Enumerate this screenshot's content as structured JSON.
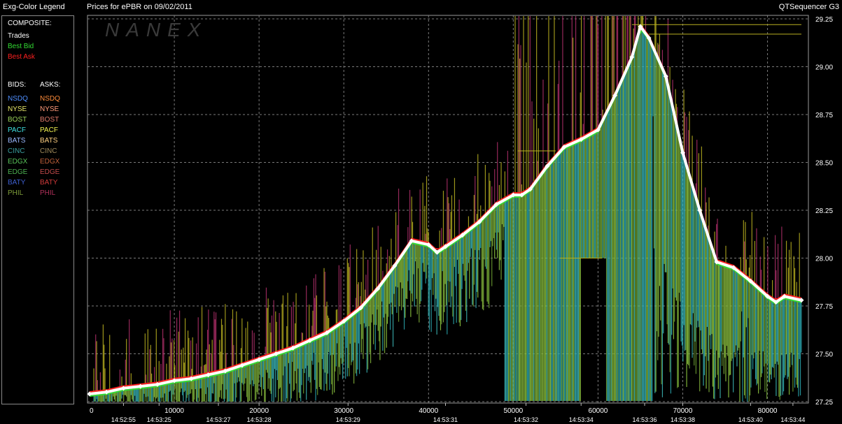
{
  "header": {
    "legend_title": "Exg-Color Legend",
    "chart_title": "Prices for  ePBR  on  09/02/2011",
    "app_name": "QTSequencer G3"
  },
  "legend": {
    "composite_label": "COMPOSITE:",
    "composite_items": [
      {
        "label": "Trades",
        "color": "#ffffff"
      },
      {
        "label": "Best Bid",
        "color": "#33dd33"
      },
      {
        "label": "Best Ask",
        "color": "#ff2020"
      }
    ],
    "bids_label": "BIDS:",
    "asks_label": "ASKS:",
    "bids": [
      {
        "label": "NSDQ",
        "color": "#4f8fff"
      },
      {
        "label": "NYSE",
        "color": "#e8e86a"
      },
      {
        "label": "BOST",
        "color": "#9ad25a"
      },
      {
        "label": "PACF",
        "color": "#40e0e0"
      },
      {
        "label": "BATS",
        "color": "#9ab8ff"
      },
      {
        "label": "CINC",
        "color": "#3aa0a0"
      },
      {
        "label": "EDGX",
        "color": "#59c45a"
      },
      {
        "label": "EDGE",
        "color": "#4caf50"
      },
      {
        "label": "BATY",
        "color": "#3e5fd0"
      },
      {
        "label": "PHIL",
        "color": "#7f9e3a"
      }
    ],
    "asks": [
      {
        "label": "NSDQ",
        "color": "#ff8c3a"
      },
      {
        "label": "NYSE",
        "color": "#ff9a7a"
      },
      {
        "label": "BOST",
        "color": "#e07a6a"
      },
      {
        "label": "PACF",
        "color": "#f0f050"
      },
      {
        "label": "BATS",
        "color": "#ffd080"
      },
      {
        "label": "CINC",
        "color": "#a08a5a"
      },
      {
        "label": "EDGX",
        "color": "#c0603a"
      },
      {
        "label": "EDGE",
        "color": "#c04a4a"
      },
      {
        "label": "BATY",
        "color": "#d03a3a"
      },
      {
        "label": "PHIL",
        "color": "#b0305a"
      }
    ]
  },
  "watermark": "NANEX",
  "chart_data": {
    "type": "line",
    "x_range": [
      0,
      84000
    ],
    "ylim": [
      27.25,
      29.25
    ],
    "grid": true,
    "x_ticks": [
      0,
      10000,
      20000,
      30000,
      40000,
      50000,
      60000,
      70000,
      80000
    ],
    "x_tick_labels": [
      "0",
      "10000",
      "20000",
      "30000",
      "40000",
      "50000",
      "60000",
      "70000",
      "80000"
    ],
    "time_labels": [
      {
        "x": 4000,
        "label": "14:52:55"
      },
      {
        "x": 8200,
        "label": "14:53:25"
      },
      {
        "x": 15200,
        "label": "14:53:27"
      },
      {
        "x": 20000,
        "label": "14:53:28"
      },
      {
        "x": 30500,
        "label": "14:53:29"
      },
      {
        "x": 42000,
        "label": "14:53:31"
      },
      {
        "x": 51500,
        "label": "14:53:32"
      },
      {
        "x": 58000,
        "label": "14:53:34"
      },
      {
        "x": 65500,
        "label": "14:53:36"
      },
      {
        "x": 70000,
        "label": "14:53:38"
      },
      {
        "x": 78000,
        "label": "14:53:40"
      },
      {
        "x": 83000,
        "label": "14:53:44"
      }
    ],
    "y_ticks": [
      27.25,
      27.5,
      27.75,
      28.0,
      28.25,
      28.5,
      28.75,
      29.0,
      29.25
    ],
    "y_tick_labels": [
      "27.25",
      "27.50",
      "27.75",
      "28.00",
      "28.25",
      "28.50",
      "28.75",
      "29.00",
      "29.25"
    ],
    "series": [
      {
        "name": "Trades",
        "color": "#ffffff",
        "x": [
          0,
          2000,
          4000,
          6000,
          8000,
          10000,
          12000,
          14000,
          16000,
          18000,
          20000,
          22000,
          24000,
          26000,
          28000,
          30000,
          32000,
          34000,
          36000,
          38000,
          40000,
          41000,
          42000,
          44000,
          46000,
          48000,
          50000,
          51000,
          52000,
          54000,
          56000,
          58000,
          60000,
          62000,
          64000,
          65000,
          66000,
          68000,
          70000,
          72000,
          74000,
          76000,
          78000,
          80000,
          81000,
          82000,
          84000
        ],
        "y": [
          27.29,
          27.3,
          27.32,
          27.33,
          27.34,
          27.36,
          27.37,
          27.39,
          27.41,
          27.44,
          27.47,
          27.5,
          27.53,
          27.57,
          27.61,
          27.67,
          27.74,
          27.84,
          27.96,
          28.09,
          28.07,
          28.03,
          28.06,
          28.12,
          28.19,
          28.28,
          28.33,
          28.33,
          28.36,
          28.48,
          28.58,
          28.62,
          28.67,
          28.85,
          29.05,
          29.21,
          29.15,
          28.95,
          28.55,
          28.25,
          27.98,
          27.95,
          27.88,
          27.8,
          27.77,
          27.8,
          27.78
        ]
      }
    ]
  }
}
